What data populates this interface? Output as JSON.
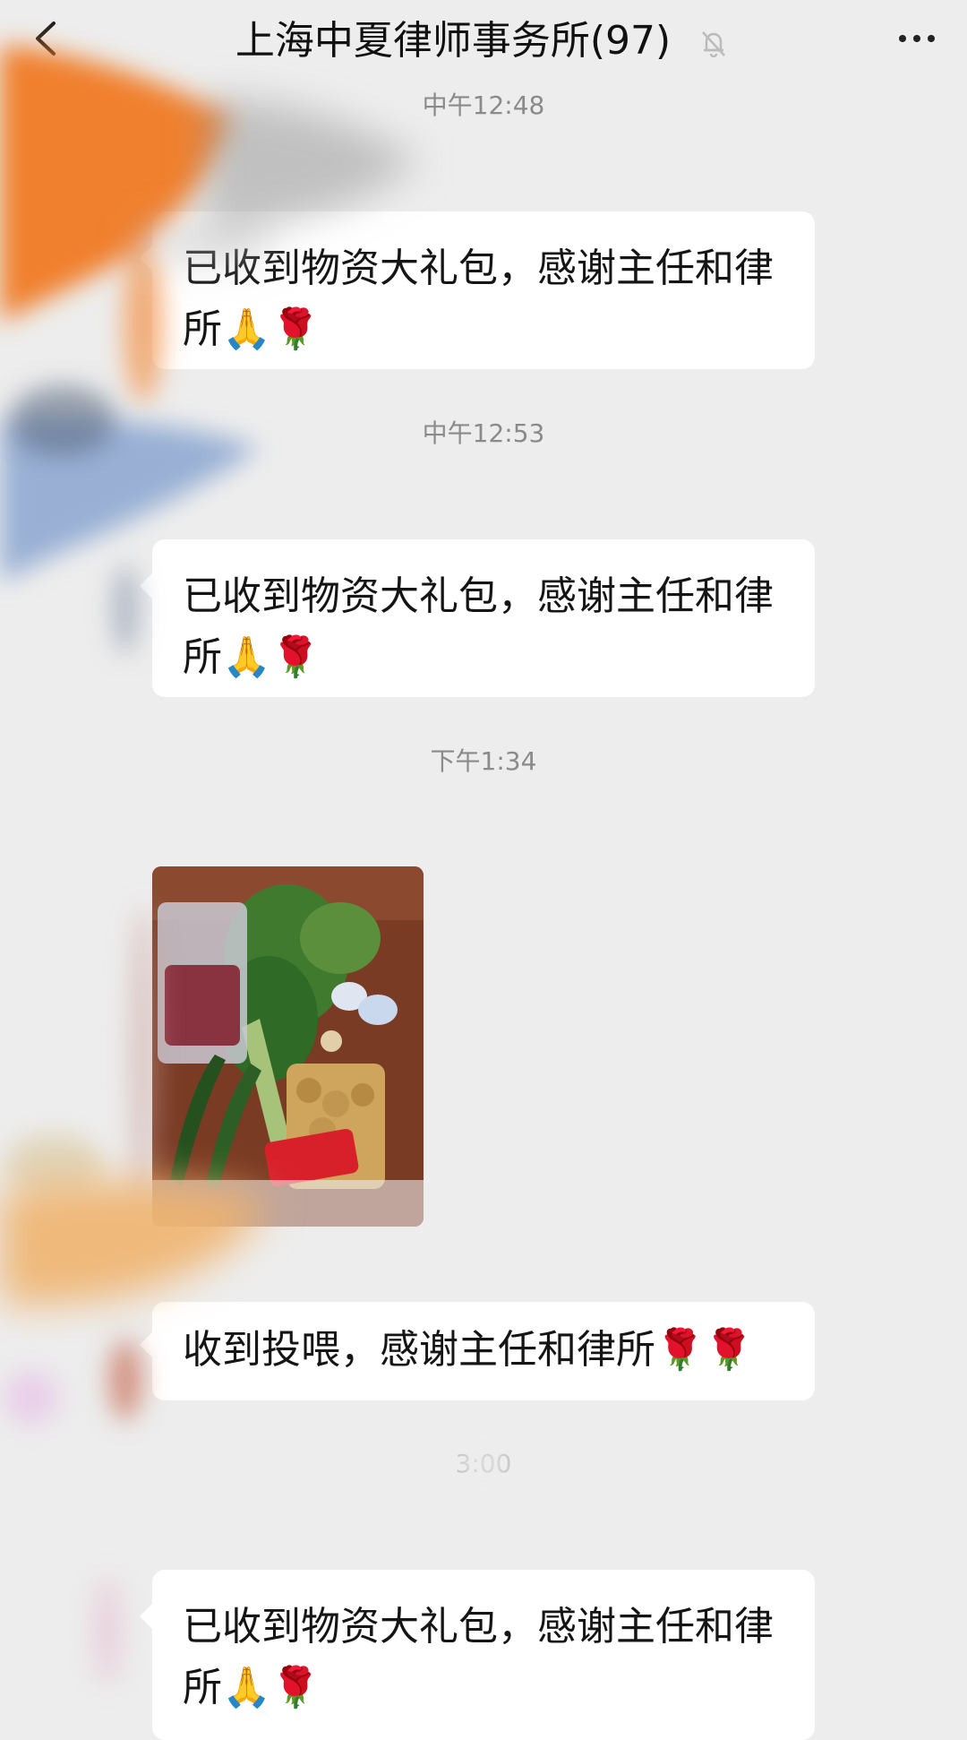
{
  "nav": {
    "title": "上海中夏律师事务所(97)",
    "back_icon": "chevron-left-icon",
    "mute_icon": "bell-off-icon",
    "more_icon": "more-horizontal-icon"
  },
  "messages": [
    {
      "time": "中午12:48",
      "text": "已收到物资大礼包，感谢主任和律所🙏🌹"
    },
    {
      "time": "中午12:53",
      "text": "已收到物资大礼包，感谢主任和律所🙏🌹"
    },
    {
      "time": "下午1:34",
      "image": "groceries-photo"
    },
    {
      "text": "收到投喂，感谢主任和律所🌹🌹"
    },
    {
      "time": "3:00",
      "text": "已收到物资大礼包，感谢主任和律所🙏🌹"
    }
  ],
  "colors": {
    "background": "#ededed",
    "bubble": "#ffffff",
    "timestamp": "#8a8a8a"
  }
}
